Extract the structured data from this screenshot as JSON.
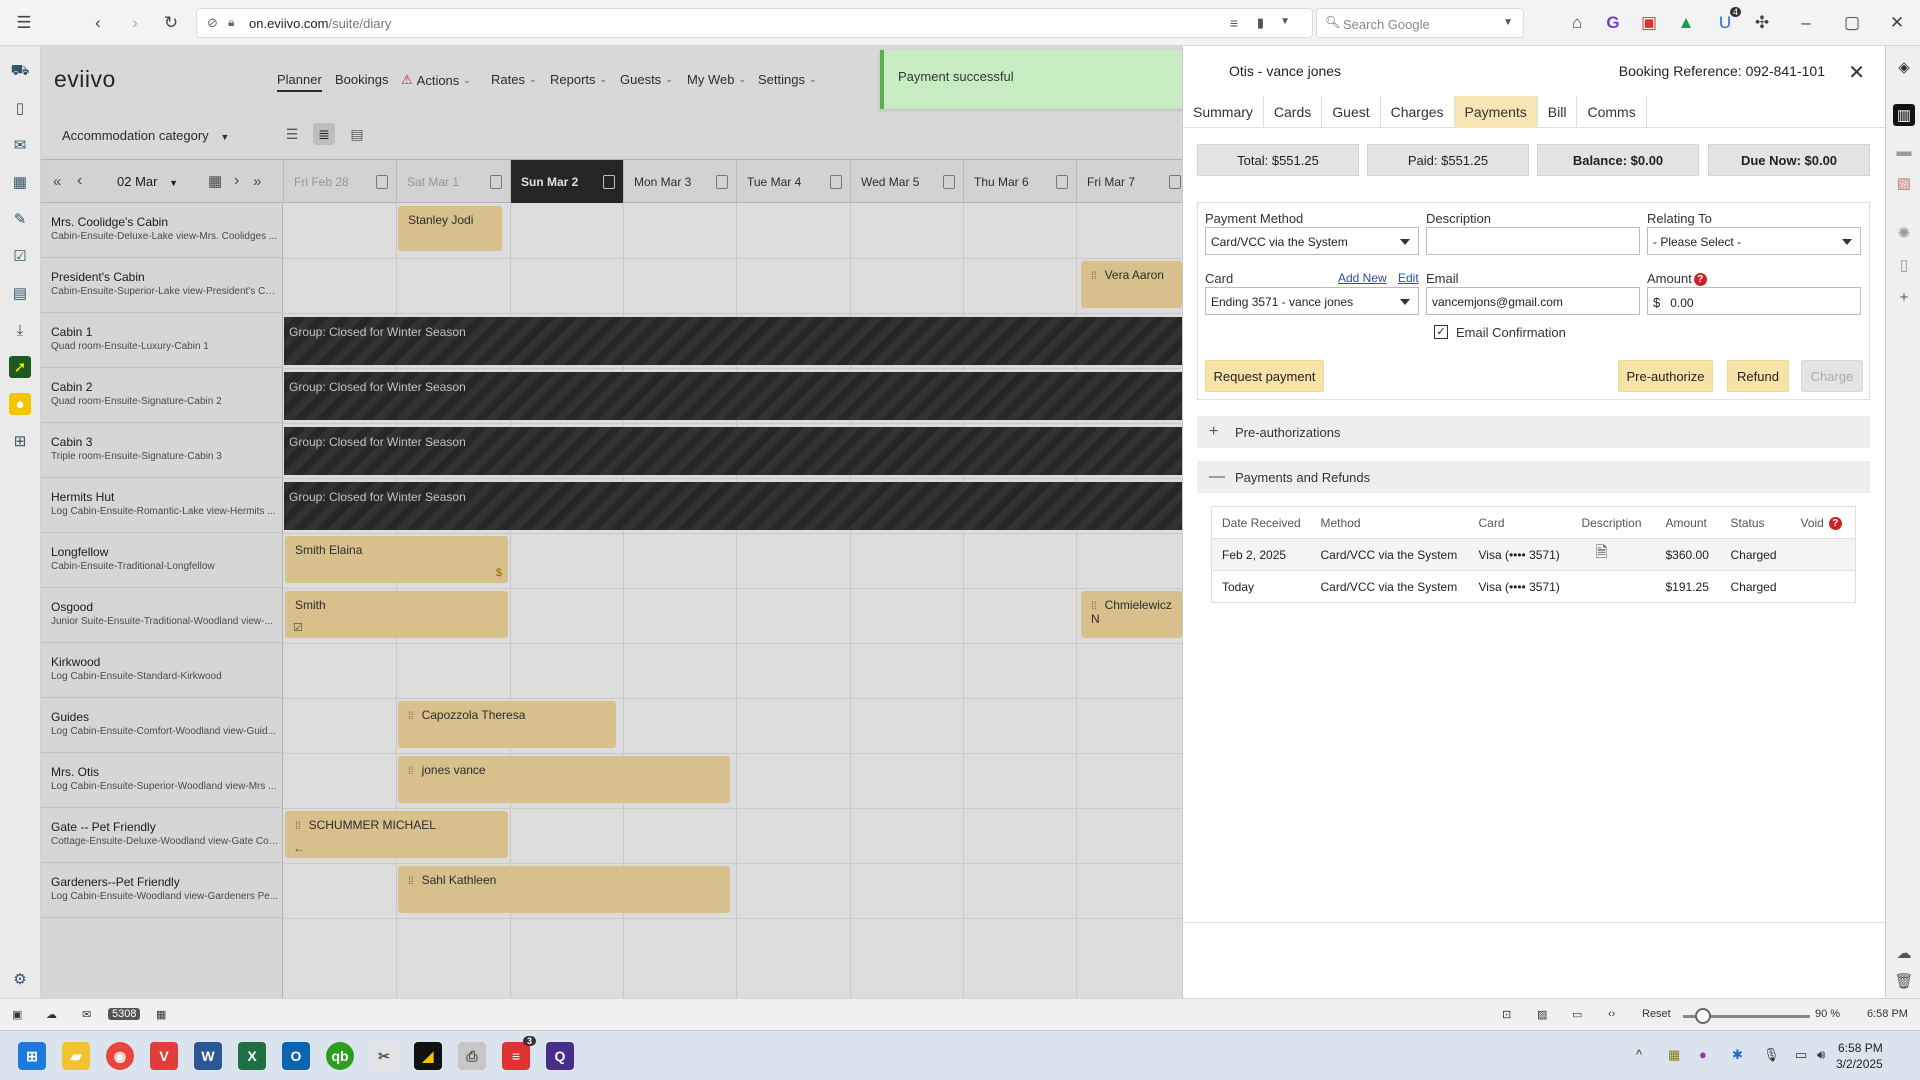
{
  "browser": {
    "url_host": "on.eviivo.com",
    "url_path": "/suite/diary",
    "search_placeholder": "Search Google",
    "extension_badge": "4",
    "status": {
      "mail_count": "5308",
      "reset_label": "Reset",
      "zoom": "90 %",
      "time": "6:58 PM"
    }
  },
  "app": {
    "logo": "eviivo",
    "nav": [
      {
        "label": "Planner"
      },
      {
        "label": "Bookings"
      },
      {
        "label": "Actions"
      },
      {
        "label": "Rates"
      },
      {
        "label": "Reports"
      },
      {
        "label": "Guests"
      },
      {
        "label": "My Web"
      },
      {
        "label": "Settings"
      }
    ],
    "category_select": "Accommodation category",
    "date_select": "02 Mar",
    "dates": [
      "Fri Feb 28",
      "Sat Mar 1",
      "Sun Mar 2",
      "Mon Mar 3",
      "Tue Mar 4",
      "Wed Mar 5",
      "Thu Mar 6",
      "Fri Mar 7"
    ],
    "rooms": [
      {
        "name": "Mrs. Coolidge's Cabin",
        "desc": "Cabin-Ensuite-Deluxe-Lake view-Mrs. Coolidges ..."
      },
      {
        "name": "President's Cabin",
        "desc": "Cabin-Ensuite-Superior-Lake view-President's Ca..."
      },
      {
        "name": "Cabin 1",
        "desc": "Quad room-Ensuite-Luxury-Cabin 1"
      },
      {
        "name": "Cabin 2",
        "desc": "Quad room-Ensuite-Signature-Cabin 2"
      },
      {
        "name": "Cabin 3",
        "desc": "Triple room-Ensuite-Signature-Cabin 3"
      },
      {
        "name": "Hermits Hut",
        "desc": "Log Cabin-Ensuite-Romantic-Lake view-Hermits ..."
      },
      {
        "name": "Longfellow",
        "desc": "Cabin-Ensuite-Traditional-Longfellow"
      },
      {
        "name": "Osgood",
        "desc": "Junior Suite-Ensuite-Traditional-Woodland view-..."
      },
      {
        "name": "Kirkwood",
        "desc": "Log Cabin-Ensuite-Standard-Kirkwood"
      },
      {
        "name": "Guides",
        "desc": "Log Cabin-Ensuite-Comfort-Woodland view-Guid..."
      },
      {
        "name": "Mrs. Otis",
        "desc": "Log Cabin-Ensuite-Superior-Woodland view-Mrs ..."
      },
      {
        "name": "Gate -- Pet Friendly",
        "desc": "Cottage-Ensuite-Deluxe-Woodland view-Gate Cot..."
      },
      {
        "name": "Gardeners--Pet Friendly",
        "desc": "Log Cabin-Ensuite-Woodland view-Gardeners Pe..."
      }
    ],
    "bookings": [
      {
        "guest": "Stanley Jodi"
      },
      {
        "guest": "Vera Aaron"
      },
      {
        "guest": "Smith Elaina",
        "mark": "$"
      },
      {
        "guest": "Smith"
      },
      {
        "guest": "Chmielewicz N"
      },
      {
        "guest": "Capozzola Theresa"
      },
      {
        "guest": "jones vance"
      },
      {
        "guest": "SCHUMMER MICHAEL"
      },
      {
        "guest": "Sahl Kathleen"
      }
    ],
    "closed_label": "Group: Closed for Winter Season"
  },
  "toast": {
    "message": "Payment successful"
  },
  "panel": {
    "title": "Otis - vance jones",
    "booking_ref": "Booking Reference: 092-841-101",
    "tabs": [
      "Summary",
      "Cards",
      "Guest",
      "Charges",
      "Payments",
      "Bill",
      "Comms"
    ],
    "active_tab": "Payments",
    "totals": {
      "total": "Total: $551.25",
      "paid": "Paid: $551.25",
      "balance": "Balance: $0.00",
      "due": "Due Now: $0.00"
    },
    "form": {
      "payment_method_label": "Payment Method",
      "payment_method_value": "Card/VCC via the System",
      "description_label": "Description",
      "description_value": "",
      "relating_label": "Relating To",
      "relating_value": "- Please Select -",
      "card_label": "Card",
      "add_new": "Add New",
      "edit": "Edit",
      "card_value": "Ending 3571 - vance jones",
      "email_label": "Email",
      "email_value": "vancemjons@gmail.com",
      "amount_label": "Amount",
      "currency": "$",
      "amount_value": "0.00",
      "email_confirm_label": "Email Confirmation",
      "email_confirm_checked": true
    },
    "buttons": {
      "request_payment": "Request payment",
      "pre_authorize": "Pre-authorize",
      "refund": "Refund",
      "charge": "Charge"
    },
    "preauth_label": "Pre-authorizations",
    "payments_label": "Payments and Refunds",
    "table": {
      "headers": [
        "Date Received",
        "Method",
        "Card",
        "Description",
        "Amount",
        "Status",
        "Void"
      ],
      "rows": [
        {
          "date": "Feb 2, 2025",
          "method": "Card/VCC via the System",
          "card": "Visa (•••• 3571)",
          "amount": "$360.00",
          "status": "Charged"
        },
        {
          "date": "Today",
          "method": "Card/VCC via the System",
          "card": "Visa (•••• 3571)",
          "amount": "$191.25",
          "status": "Charged"
        }
      ]
    }
  },
  "taskbar": {
    "badge": "3",
    "time": "6:58 PM",
    "date": "3/2/2025"
  }
}
